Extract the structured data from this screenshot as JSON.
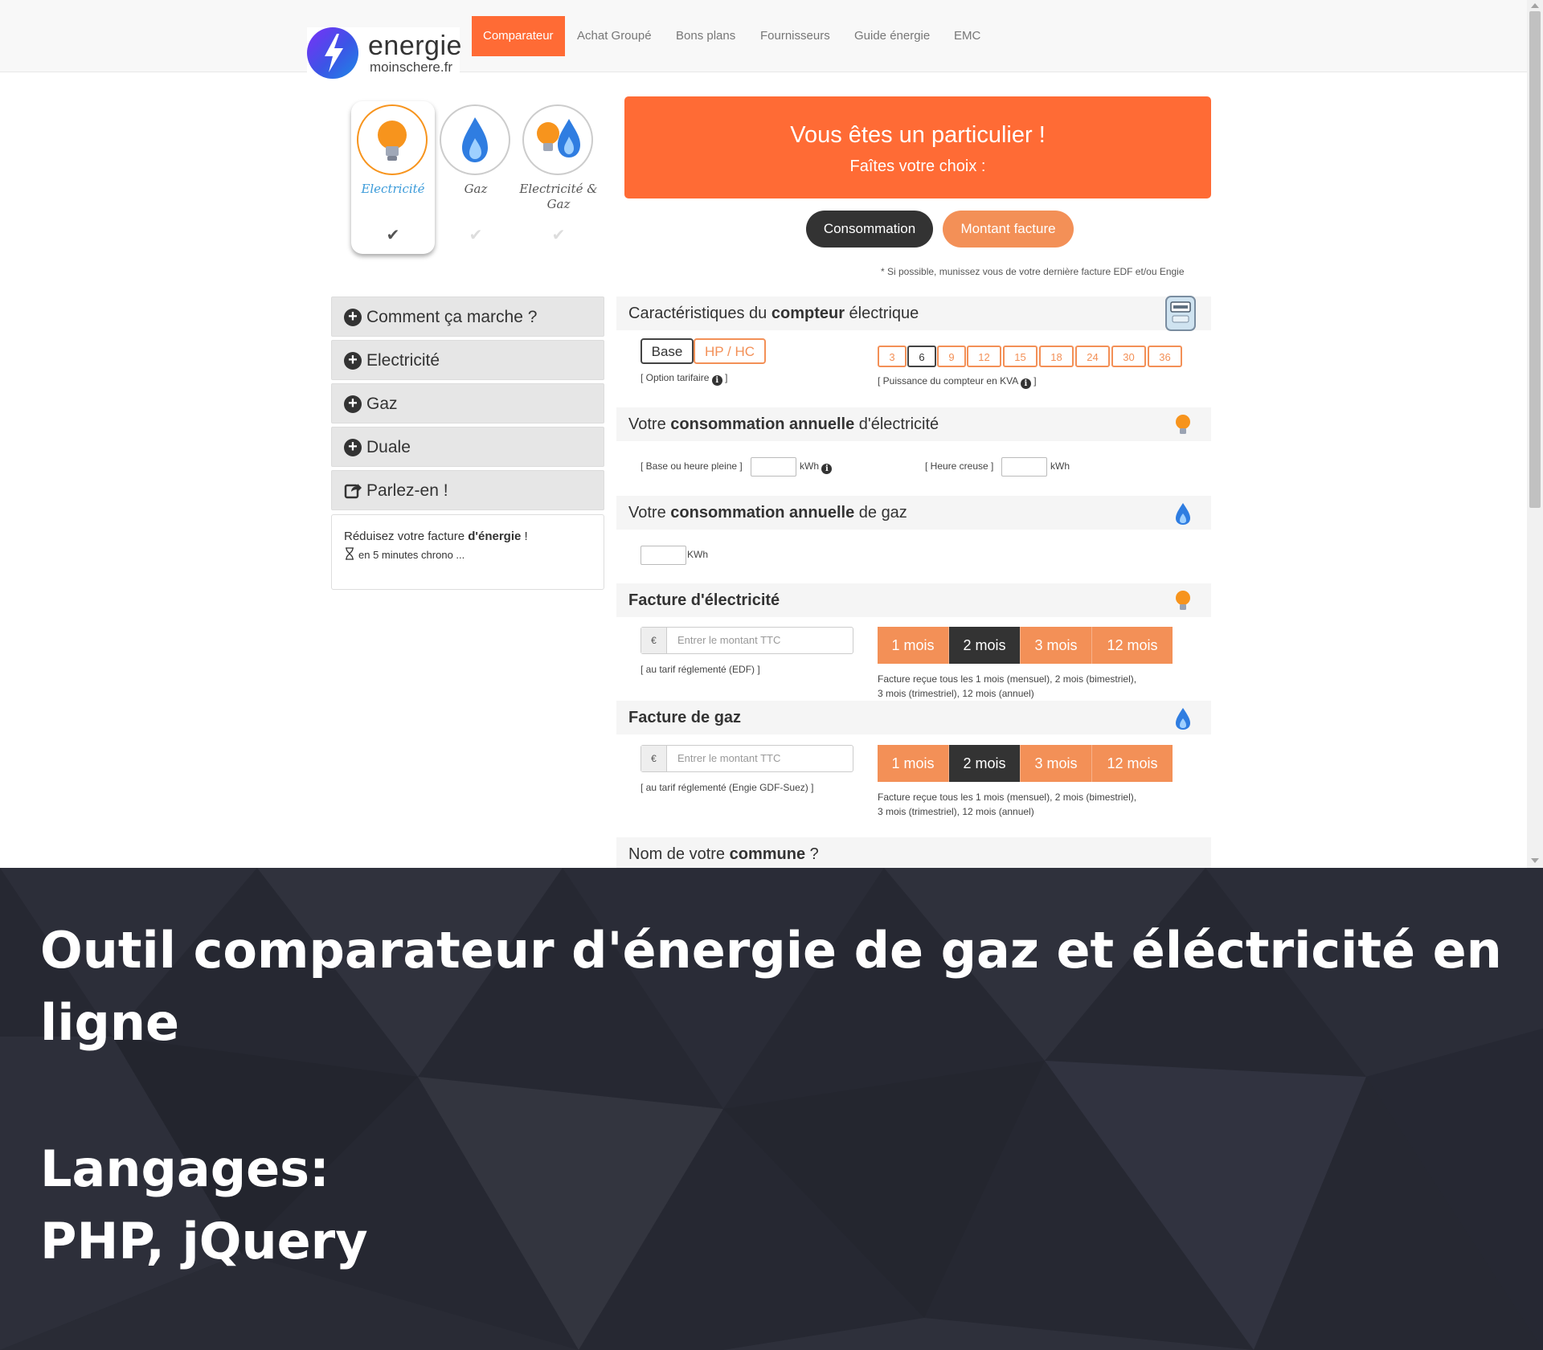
{
  "logo": {
    "word1": "energie",
    "word2": "moinschere.fr"
  },
  "nav": {
    "items": [
      {
        "label": "Comparateur",
        "active": true
      },
      {
        "label": "Achat Groupé",
        "active": false
      },
      {
        "label": "Bons plans",
        "active": false
      },
      {
        "label": "Fournisseurs",
        "active": false
      },
      {
        "label": "Guide énergie",
        "active": false
      },
      {
        "label": "EMC",
        "active": false
      }
    ]
  },
  "energy": {
    "options": [
      {
        "label": "Electricité",
        "selected": true,
        "icon": "bulb-icon"
      },
      {
        "label": "Gaz",
        "selected": false,
        "icon": "flame-icon"
      },
      {
        "label": "Electricité & Gaz",
        "selected": false,
        "icon": "bulb-flame-icon"
      }
    ],
    "check": "✔"
  },
  "banner": {
    "title": "Vous êtes un particulier !",
    "subtitle": "Faîtes votre choix :"
  },
  "mode": {
    "consommation": "Consommation",
    "montant": "Montant facture",
    "active": "Consommation"
  },
  "note": "* Si possible, munissez vous de votre dernière facture EDF et/ou Engie",
  "sidebar": {
    "items": [
      {
        "label": "Comment ça marche ?",
        "icon": "plus-circle-icon"
      },
      {
        "label": "Electricité",
        "icon": "plus-circle-icon"
      },
      {
        "label": "Gaz",
        "icon": "plus-circle-icon"
      },
      {
        "label": "Duale",
        "icon": "plus-circle-icon"
      },
      {
        "label": "Parlez-en !",
        "icon": "share-icon"
      }
    ],
    "box": {
      "line1_pre": "Réduisez votre facture ",
      "line1_bold": "d'énergie",
      "line1_post": " !",
      "line2": "en 5 minutes chrono ..."
    }
  },
  "compteur": {
    "title_pre": "Caractéristiques du ",
    "title_bold": "compteur",
    "title_post": " électrique",
    "options": [
      "Base",
      "HP / HC"
    ],
    "selected_option": "Base",
    "option_label": "[ Option tarifaire",
    "option_label_end": "]",
    "kva": [
      "3",
      "6",
      "9",
      "12",
      "15",
      "18",
      "24",
      "30",
      "36"
    ],
    "selected_kva": "6",
    "kva_label": "[ Puissance du compteur en KVA",
    "kva_label_end": "]"
  },
  "conso_elec": {
    "title_pre": "Votre ",
    "title_bold": "consommation annuelle",
    "title_post": " d'électricité",
    "base_label": "[ Base ou heure pleine ]",
    "unit": "kWh",
    "creuse_label": "[ Heure creuse ]",
    "unit2": "kWh"
  },
  "conso_gaz": {
    "title_pre": "Votre ",
    "title_bold": "consommation annuelle",
    "title_post": " de gaz",
    "unit": "KWh"
  },
  "facture_elec": {
    "title": "Facture d'électricité",
    "currency": "€",
    "placeholder": "Entrer le montant TTC",
    "note": "[ au tarif réglementé (EDF) ]",
    "periods": [
      "1 mois",
      "2 mois",
      "3 mois",
      "12 mois"
    ],
    "active_period": "2 mois",
    "period_note_1": "Facture reçue tous les 1 mois (mensuel), 2 mois (bimestriel),",
    "period_note_2": "3 mois (trimestriel), 12 mois (annuel)"
  },
  "facture_gaz": {
    "title": "Facture de gaz",
    "currency": "€",
    "placeholder": "Entrer le montant TTC",
    "note": "[ au tarif réglementé (Engie GDF-Suez) ]",
    "periods": [
      "1 mois",
      "2 mois",
      "3 mois",
      "12 mois"
    ],
    "active_period": "2 mois",
    "period_note_1": "Facture reçue tous les 1 mois (mensuel), 2 mois (bimestriel),",
    "period_note_2": "3 mois (trimestriel), 12 mois (annuel)"
  },
  "commune": {
    "title_pre": "Nom de votre ",
    "title_bold": "commune",
    "title_post": " ?"
  },
  "caption": {
    "title": "Outil comparateur d'énergie de gaz et éléctricité en ligne",
    "lang_label": "Langages:",
    "lang_value": "PHP, jQuery"
  },
  "colors": {
    "accent": "#ff6b35",
    "accent_light": "#f39057",
    "dark": "#333333",
    "bottom_bg": "#262832"
  }
}
